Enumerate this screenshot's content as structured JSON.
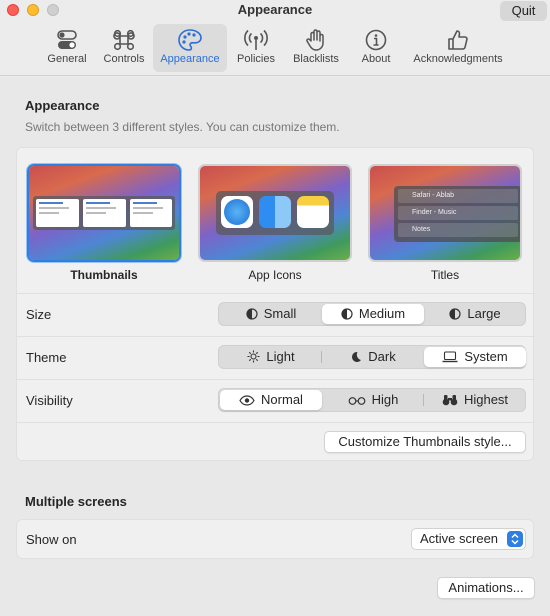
{
  "window": {
    "title": "Appearance",
    "quit_label": "Quit"
  },
  "tabs": [
    {
      "label": "General",
      "icon": "toggle-icon"
    },
    {
      "label": "Controls",
      "icon": "command-icon"
    },
    {
      "label": "Appearance",
      "icon": "palette-icon",
      "active": true
    },
    {
      "label": "Policies",
      "icon": "antenna-icon"
    },
    {
      "label": "Blacklists",
      "icon": "hand-icon"
    },
    {
      "label": "About",
      "icon": "info-icon"
    },
    {
      "label": "Acknowledgments",
      "icon": "thumbs-up-icon"
    }
  ],
  "appearance": {
    "title": "Appearance",
    "subtitle": "Switch between 3 different styles. You can customize them.",
    "styles": [
      {
        "label": "Thumbnails",
        "selected": true
      },
      {
        "label": "App Icons",
        "selected": false
      },
      {
        "label": "Titles",
        "selected": false
      }
    ],
    "titles_preview": [
      "Safari - Ablab",
      "Finder - Music",
      "Notes"
    ],
    "size": {
      "label": "Size",
      "options": [
        "Small",
        "Medium",
        "Large"
      ],
      "selected": "Medium"
    },
    "theme": {
      "label": "Theme",
      "options": [
        "Light",
        "Dark",
        "System"
      ],
      "selected": "System"
    },
    "visibility": {
      "label": "Visibility",
      "options": [
        "Normal",
        "High",
        "Highest"
      ],
      "selected": "Normal"
    },
    "customize_label": "Customize Thumbnails style..."
  },
  "multiple_screens": {
    "title": "Multiple screens",
    "show_on_label": "Show on",
    "show_on_value": "Active screen"
  },
  "animations_label": "Animations...",
  "colors": {
    "accent": "#2f7fe2",
    "close": "#ff5f57",
    "minimize": "#febc2e"
  }
}
